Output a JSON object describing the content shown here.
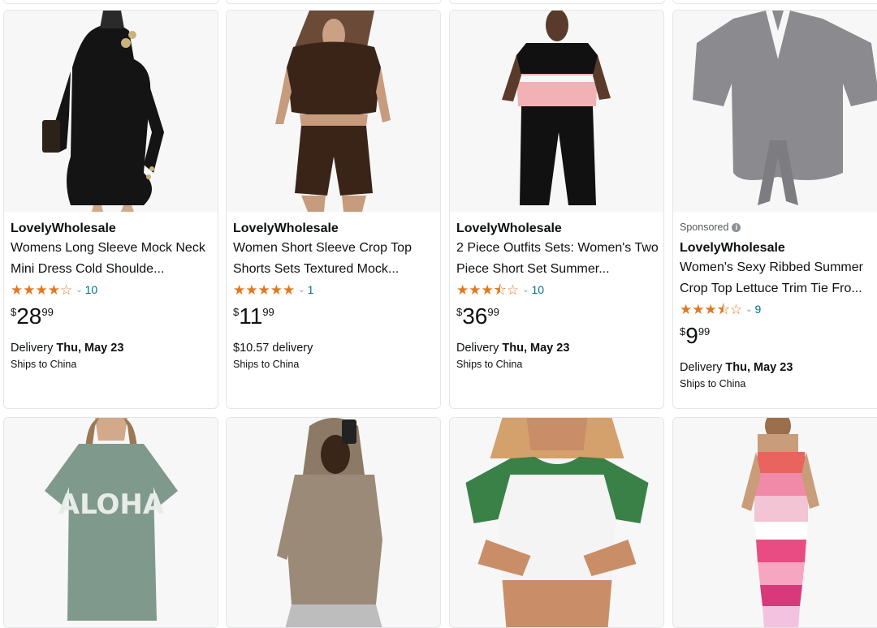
{
  "products": [
    {
      "sponsored": false,
      "brand": "LovelyWholesale",
      "title": "Womens Long Sleeve Mock Neck Mini Dress Cold Shoulde...",
      "stars": 4,
      "rating_count": "10",
      "price": {
        "symbol": "$",
        "whole": "28",
        "fraction": "99"
      },
      "delivery_prefix": "Delivery ",
      "delivery_date": "Thu, May 23",
      "ships": "Ships to China",
      "image": "black-mini-dress"
    },
    {
      "sponsored": false,
      "brand": "LovelyWholesale",
      "title": "Women Short Sleeve Crop Top Shorts Sets Textured Mock...",
      "stars": 5,
      "rating_count": "1",
      "price": {
        "symbol": "$",
        "whole": "11",
        "fraction": "99"
      },
      "delivery_prefix": "$10.57 delivery",
      "delivery_date": "",
      "ships": "Ships to China",
      "image": "brown-textured-set"
    },
    {
      "sponsored": false,
      "brand": "LovelyWholesale",
      "title": "2 Piece Outfits Sets: Women's Two Piece Short Set Summer...",
      "stars": 3.5,
      "rating_count": "10",
      "price": {
        "symbol": "$",
        "whole": "36",
        "fraction": "99"
      },
      "delivery_prefix": "Delivery ",
      "delivery_date": "Thu, May 23",
      "ships": "Ships to China",
      "image": "pink-black-two-piece"
    },
    {
      "sponsored": true,
      "sponsored_label": "Sponsored",
      "brand": "LovelyWholesale",
      "title": "Women's Sexy Ribbed Summer Crop Top Lettuce Trim Tie Fro...",
      "stars": 3.5,
      "rating_count": "9",
      "price": {
        "symbol": "$",
        "whole": "9",
        "fraction": "99"
      },
      "delivery_prefix": "Delivery ",
      "delivery_date": "Thu, May 23",
      "ships": "Ships to China",
      "image": "grey-tie-front-crop-top"
    },
    {
      "image": "aloha-tee",
      "print": "ALOHA"
    },
    {
      "image": "taupe-hooded-top"
    },
    {
      "image": "white-green-raglan-crop"
    },
    {
      "image": "pink-striped-tube-dress"
    }
  ],
  "colors": {
    "star": "#de7921",
    "link": "#007185",
    "border": "#e3e6e6"
  }
}
